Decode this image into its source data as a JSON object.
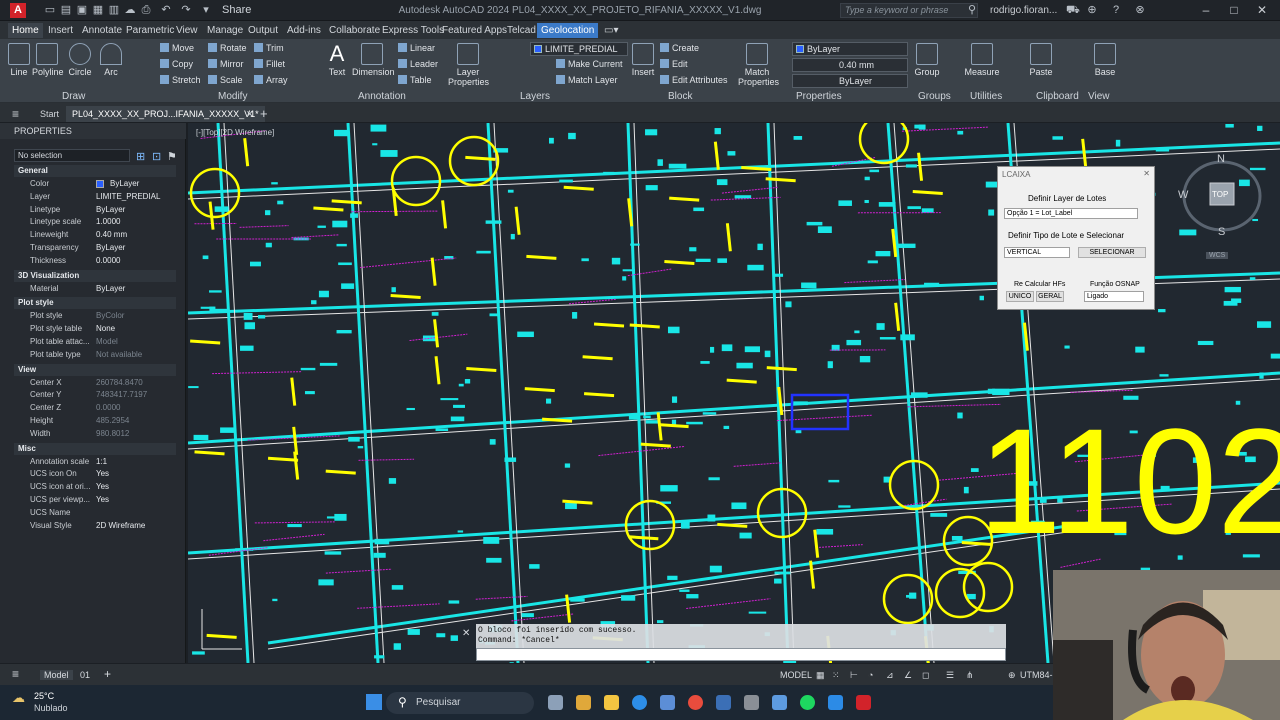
{
  "app": {
    "title": "Autodesk AutoCAD 2024    PL04_XXXX_XX_PROJETO_RIFANIA_XXXXX_V1.dwg",
    "logo": "A",
    "share": "Share",
    "search_placeholder": "Type a keyword or phrase",
    "user": "rodrigo.fioran..."
  },
  "ribbon_tabs": [
    "Home",
    "Insert",
    "Annotate",
    "Parametric",
    "View",
    "Manage",
    "Output",
    "Add-ins",
    "Collaborate",
    "Express Tools",
    "Featured Apps",
    "Telcad",
    "Geolocation"
  ],
  "ribbon": {
    "draw": {
      "title": "Draw",
      "line": "Line",
      "polyline": "Polyline",
      "circle": "Circle",
      "arc": "Arc"
    },
    "modify": {
      "title": "Modify",
      "move": "Move",
      "rotate": "Rotate",
      "trim": "Trim",
      "copy": "Copy",
      "mirror": "Mirror",
      "fillet": "Fillet",
      "stretch": "Stretch",
      "scale": "Scale",
      "array": "Array"
    },
    "annotation": {
      "title": "Annotation",
      "text": "Text",
      "dimension": "Dimension",
      "linear": "Linear",
      "leader": "Leader",
      "table": "Table"
    },
    "layers": {
      "title": "Layers",
      "layer_properties": "Layer Properties",
      "current_layer": "LIMITE_PREDIAL",
      "make_current": "Make Current",
      "match_layer": "Match Layer"
    },
    "block": {
      "title": "Block",
      "insert": "Insert",
      "create": "Create",
      "edit": "Edit",
      "edit_attributes": "Edit Attributes"
    },
    "properties": {
      "title": "Properties",
      "match": "Match Properties",
      "color": "ByLayer",
      "lineweight": "0.40 mm",
      "linetype": "ByLayer"
    },
    "groups": {
      "title": "Groups",
      "group": "Group"
    },
    "utilities": {
      "title": "Utilities",
      "measure": "Measure"
    },
    "clipboard": {
      "title": "Clipboard",
      "paste": "Paste"
    },
    "view": {
      "title": "View",
      "base": "Base"
    }
  },
  "doc_tabs": {
    "start": "Start",
    "file": "PL04_XXXX_XX_PROJ...IFANIA_XXXXX_V1*"
  },
  "properties_panel": {
    "title": "PROPERTIES",
    "selection": "No selection",
    "sections": [
      {
        "name": "General",
        "rows": [
          {
            "k": "Color",
            "v": "ByLayer"
          },
          {
            "k": "Layer",
            "v": "LIMITE_PREDIAL"
          },
          {
            "k": "Linetype",
            "v": "ByLayer"
          },
          {
            "k": "Linetype scale",
            "v": "1.0000"
          },
          {
            "k": "Lineweight",
            "v": "0.40 mm"
          },
          {
            "k": "Transparency",
            "v": "ByLayer"
          },
          {
            "k": "Thickness",
            "v": "0.0000"
          }
        ]
      },
      {
        "name": "3D Visualization",
        "rows": [
          {
            "k": "Material",
            "v": "ByLayer"
          }
        ]
      },
      {
        "name": "Plot style",
        "rows": [
          {
            "k": "Plot style",
            "v": "ByColor",
            "dim": true
          },
          {
            "k": "Plot style table",
            "v": "None"
          },
          {
            "k": "Plot table attac...",
            "v": "Model",
            "dim": true
          },
          {
            "k": "Plot table type",
            "v": "Not available",
            "dim": true
          }
        ]
      },
      {
        "name": "View",
        "rows": [
          {
            "k": "Center X",
            "v": "260784.8470",
            "dim": true
          },
          {
            "k": "Center Y",
            "v": "7483417.7197",
            "dim": true
          },
          {
            "k": "Center Z",
            "v": "0.0000",
            "dim": true
          },
          {
            "k": "Height",
            "v": "485.2954",
            "dim": true
          },
          {
            "k": "Width",
            "v": "980.8012",
            "dim": true
          }
        ]
      },
      {
        "name": "Misc",
        "rows": [
          {
            "k": "Annotation scale",
            "v": "1:1"
          },
          {
            "k": "UCS icon On",
            "v": "Yes"
          },
          {
            "k": "UCS icon at ori...",
            "v": "Yes"
          },
          {
            "k": "UCS per viewp...",
            "v": "Yes"
          },
          {
            "k": "UCS Name",
            "v": ""
          },
          {
            "k": "Visual Style",
            "v": "2D Wireframe"
          }
        ]
      }
    ]
  },
  "viewport": {
    "label": "[-][Top][2D Wireframe]",
    "big_text": "1102"
  },
  "lcaixa": {
    "title": "LCAIXA",
    "define_layer": "Definir Layer de Lotes",
    "layer_option": "Opção 1 = Lot_Label",
    "define_type": "Definir Tipo de Lote e Selecionar",
    "type_value": "VERTICAL",
    "select_btn": "SELECIONAR",
    "recalc_label": "Re Calcular HFs",
    "unico": "UNICO",
    "geral": "GERAL",
    "osnap_label": "Função OSNAP",
    "osnap_value": "Ligado"
  },
  "compass": {
    "n": "N",
    "s": "S",
    "w": "W",
    "top": "TOP",
    "wcs": "WCS"
  },
  "command": {
    "history1": "O bloco foi inserido com sucesso.",
    "history2": "Command: *Cancel*",
    "prompt": ""
  },
  "status": {
    "model_tab": "Model",
    "layout_tab": "01",
    "mode": "MODEL",
    "coord": "UTM84-"
  },
  "taskbar": {
    "temp": "25°C",
    "weather": "Nublado",
    "search": "Pesquisar"
  },
  "colors": {
    "canvas": "#212830",
    "cyan": "#19e6e6",
    "yellow": "#ffff00",
    "magenta": "#d020d0",
    "white": "#e6e6e6",
    "accent": "#3b7ac8"
  }
}
